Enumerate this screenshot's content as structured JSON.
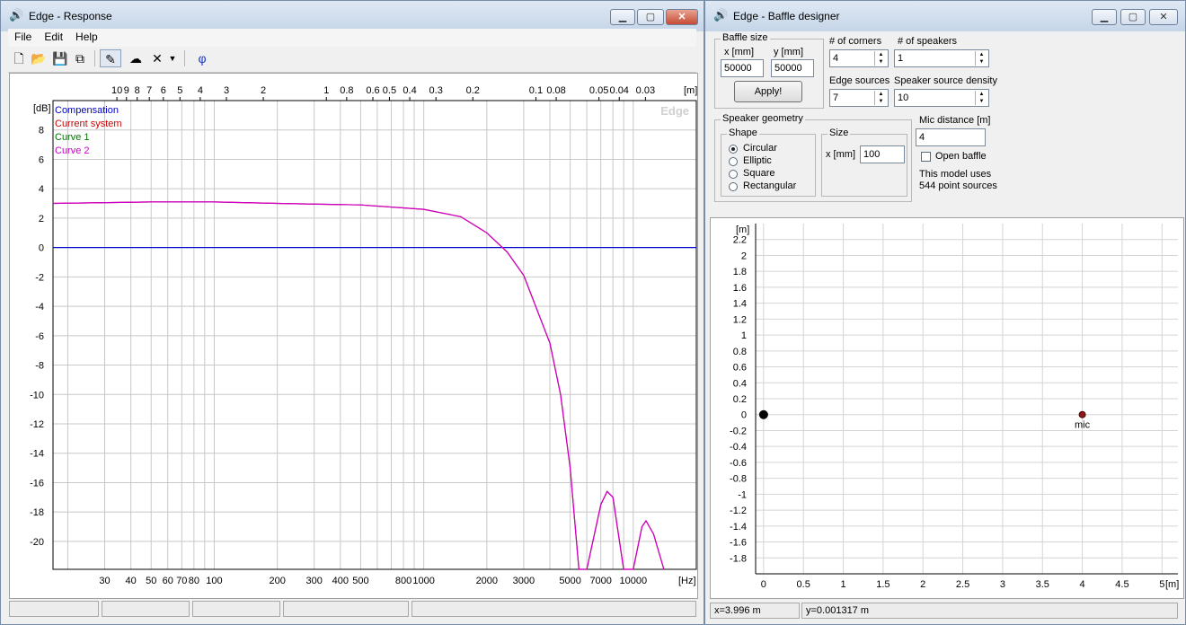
{
  "response_window": {
    "title": "Edge - Response",
    "menu": [
      "File",
      "Edit",
      "Help"
    ],
    "toolbar_icons": [
      "new-file-icon",
      "open-folder-icon",
      "save-icon",
      "copy-icon",
      "pencil-icon",
      "cloud-icon",
      "delete-x-icon",
      "dropdown-arrow-icon",
      "phase-phi-icon"
    ],
    "phi_label": "φ",
    "watermark": "Edge",
    "status_cells": [
      "",
      "",
      "",
      "",
      ""
    ]
  },
  "baffle_window": {
    "title": "Edge - Baffle designer",
    "baffle_size": {
      "label": "Baffle size",
      "x_label": "x [mm]",
      "y_label": "y [mm]",
      "x_value": "50000",
      "y_value": "50000",
      "apply_label": "Apply!"
    },
    "corners": {
      "label": "# of corners",
      "value": "4"
    },
    "speakers": {
      "label": "# of speakers",
      "value": "1"
    },
    "edge_sources": {
      "label": "Edge sources",
      "value": "7"
    },
    "density": {
      "label": "Speaker source density",
      "value": "10"
    },
    "geometry": {
      "label": "Speaker geometry",
      "shape_label": "Shape",
      "shapes": [
        "Circular",
        "Elliptic",
        "Square",
        "Rectangular"
      ],
      "selected": "Circular",
      "size_label": "Size",
      "size_field_label": "x [mm]",
      "size_value": "100"
    },
    "mic_distance": {
      "label": "Mic distance [m]",
      "value": "4"
    },
    "open_baffle": {
      "label": "Open baffle",
      "checked": false
    },
    "model_info": [
      "This model uses",
      "544 point sources"
    ],
    "status": {
      "x": "x=3.996 m",
      "y": "y=0.001317 m"
    }
  },
  "chart_data": [
    {
      "type": "line",
      "xscale": "log",
      "xlabel": "[Hz]",
      "ylabel": "[dB]",
      "top_axis_label": "[m]",
      "xlim": [
        17,
        20000
      ],
      "ylim": [
        -21.9,
        10
      ],
      "x_ticks": [
        30,
        40,
        50,
        60,
        70,
        80,
        100,
        200,
        300,
        400,
        500,
        800,
        1000,
        2000,
        3000,
        5000,
        7000,
        10000
      ],
      "x_tick_labels": [
        "30",
        "40",
        "50",
        "60",
        "70",
        "80",
        "100",
        "200",
        "300",
        "400",
        "500",
        "800",
        "1000",
        "2000",
        "3000",
        "5000",
        "7000",
        "10000"
      ],
      "y_ticks": [
        8,
        6,
        4,
        2,
        0,
        -2,
        -4,
        -6,
        -8,
        -10,
        -12,
        -14,
        -16,
        -18,
        -20
      ],
      "top_ticks": [
        10,
        9,
        8,
        7,
        6,
        5,
        4,
        3,
        2,
        1,
        0.8,
        0.6,
        0.5,
        0.4,
        0.3,
        0.2,
        0.1,
        0.08,
        0.05,
        0.04,
        0.03
      ],
      "top_tick_labels": [
        "10",
        "9",
        "8",
        "7",
        "6",
        "5",
        "4",
        "3",
        "2",
        "1",
        "0.8",
        "0.6",
        "0.5",
        "0.4",
        "0.3",
        "0.2",
        "0.1",
        "0.08",
        "0.05",
        "0.04",
        "0.03"
      ],
      "legend": [
        "Compensation",
        "Current system",
        "Curve 1",
        "Curve 2"
      ],
      "legend_position": "top-left",
      "grid": true,
      "colors": {
        "Compensation": "#0000cc",
        "Current system": "#cc0000",
        "Curve 1": "#007700",
        "Curve 2": "#cc00cc"
      },
      "series": [
        {
          "name": "Compensation",
          "x": [
            17,
            20000
          ],
          "y": [
            0,
            0
          ]
        },
        {
          "name": "Current system",
          "x": [
            17,
            50,
            100,
            200,
            500,
            1000,
            1500,
            2000,
            2500,
            3000,
            4000,
            4500,
            5000,
            5500,
            6000,
            7000,
            7500,
            8000,
            9000,
            10000,
            11000,
            11500,
            12500,
            14000
          ],
          "y": [
            3.0,
            3.1,
            3.1,
            3.0,
            2.9,
            2.6,
            2.1,
            1.0,
            -0.3,
            -1.9,
            -6.5,
            -10.0,
            -15.0,
            -22,
            -22,
            -17.5,
            -16.6,
            -17.0,
            -22,
            -22,
            -19.0,
            -18.6,
            -19.5,
            -22
          ]
        },
        {
          "name": "Curve 2",
          "x": [
            17,
            50,
            100,
            200,
            500,
            1000,
            1500,
            2000,
            2500,
            3000,
            4000,
            4500,
            5000,
            5500,
            6000,
            7000,
            7500,
            8000,
            9000,
            10000,
            11000,
            11500,
            12500,
            14000
          ],
          "y": [
            3.0,
            3.1,
            3.1,
            3.0,
            2.9,
            2.6,
            2.1,
            1.0,
            -0.3,
            -1.9,
            -6.5,
            -10.0,
            -15.0,
            -22,
            -22,
            -17.5,
            -16.6,
            -17.0,
            -22,
            -22,
            -19.0,
            -18.6,
            -19.5,
            -22
          ]
        }
      ]
    },
    {
      "type": "scatter",
      "xlabel": "[m]",
      "ylabel": "[m]",
      "xlim": [
        -0.1,
        5.2
      ],
      "ylim": [
        -2.0,
        2.4
      ],
      "x_ticks": [
        0,
        0.5,
        1,
        1.5,
        2,
        2.5,
        3,
        3.5,
        4,
        4.5,
        5
      ],
      "x_tick_labels": [
        "0",
        "0.5",
        "1",
        "1.5",
        "2",
        "2.5",
        "3",
        "3.5",
        "4",
        "4.5",
        "5"
      ],
      "y_ticks": [
        2.2,
        2,
        1.8,
        1.6,
        1.4,
        1.2,
        1,
        0.8,
        0.6,
        0.4,
        0.2,
        0,
        -0.2,
        -0.4,
        -0.6,
        -0.8,
        -1,
        -1.2,
        -1.4,
        -1.6,
        -1.8
      ],
      "y_tick_labels": [
        "2.2",
        "2",
        "1.8",
        "1.6",
        "1.4",
        "1.2",
        "1",
        "0.8",
        "0.6",
        "0.4",
        "0.2",
        "0",
        "-0.2",
        "-0.4",
        "-0.6",
        "-0.8",
        "-1",
        "-1.2",
        "-1.4",
        "-1.6",
        "-1.8"
      ],
      "grid": true,
      "points": [
        {
          "label": "",
          "x": 0,
          "y": 0,
          "kind": "speaker"
        },
        {
          "label": "mic",
          "x": 4,
          "y": 0,
          "kind": "mic"
        }
      ]
    }
  ]
}
